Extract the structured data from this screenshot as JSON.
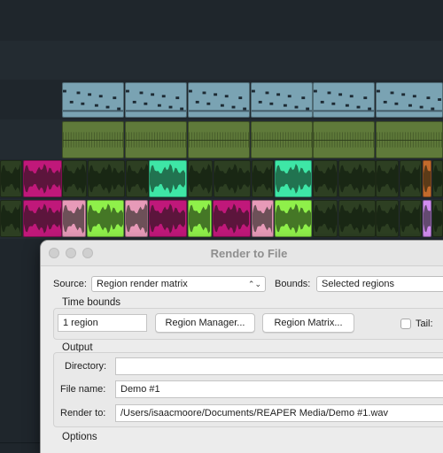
{
  "window": {
    "title": "Render to File"
  },
  "source": {
    "label": "Source:",
    "value": "Region render matrix"
  },
  "bounds": {
    "label": "Bounds:",
    "value": "Selected regions"
  },
  "time_bounds": {
    "heading": "Time bounds",
    "count_value": "1 region",
    "region_manager_label": "Region Manager...",
    "region_matrix_label": "Region Matrix...",
    "tail_label": "Tail:"
  },
  "output": {
    "heading": "Output",
    "directory_label": "Directory:",
    "directory_value": "",
    "file_name_label": "File name:",
    "file_name_value": "Demo #1",
    "render_to_label": "Render to:",
    "render_to_value": "/Users/isaacmoore/Documents/REAPER Media/Demo #1.wav"
  },
  "options": {
    "heading": "Options"
  },
  "colors": {
    "midi_blue": "#7aa3b3",
    "audio_green": "#5f7a3a",
    "clip_magenta": "#c0187a",
    "clip_mint": "#3ee6a6",
    "clip_lime": "#8ff04a",
    "clip_pink": "#e79ab8",
    "dialog_bg": "#ececec"
  },
  "icons": {
    "popup_chevron": "chevron-updown-icon",
    "window_controls": "traffic-light-icon"
  }
}
